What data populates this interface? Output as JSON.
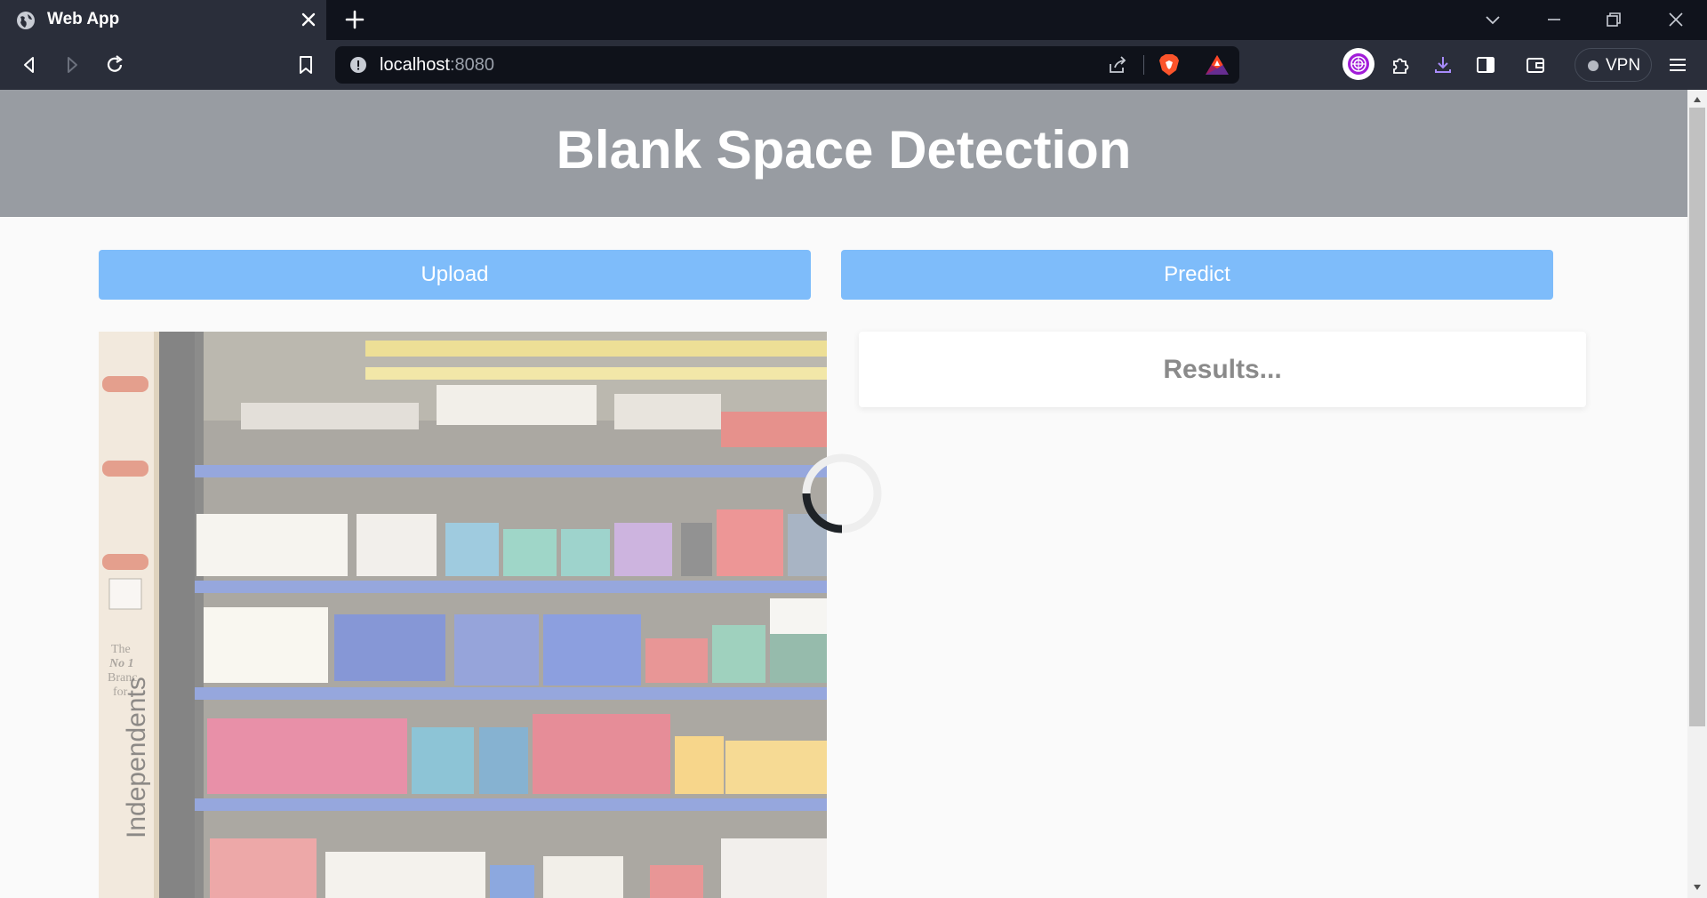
{
  "browser": {
    "tab": {
      "title": "Web App"
    },
    "address": {
      "host": "localhost",
      "port": ":8080"
    },
    "vpn_label": "VPN"
  },
  "page": {
    "title": "Blank Space Detection",
    "upload_label": "Upload",
    "predict_label": "Predict",
    "results_text": "Results...",
    "photo_text": {
      "line1": "The",
      "line2": "No 1",
      "line3": "Branc",
      "line4": "for",
      "vertical": "Independents"
    }
  },
  "colors": {
    "header_bg": "#989ca2",
    "button_bg": "#7ebcfa",
    "chrome_bg": "#2a2e3a",
    "tabstrip_bg": "#10131c"
  },
  "icons": [
    "globe-icon",
    "close-icon",
    "plus-icon",
    "chevron-down-icon",
    "minimize-icon",
    "restore-icon",
    "window-close-icon",
    "back-icon",
    "forward-icon",
    "reload-icon",
    "bookmark-icon",
    "info-icon",
    "share-icon",
    "brave-shield-icon",
    "bat-rewards-icon",
    "leo-ai-icon",
    "extensions-icon",
    "download-icon",
    "sidebar-icon",
    "wallet-icon",
    "menu-icon",
    "loading-spinner-icon"
  ]
}
